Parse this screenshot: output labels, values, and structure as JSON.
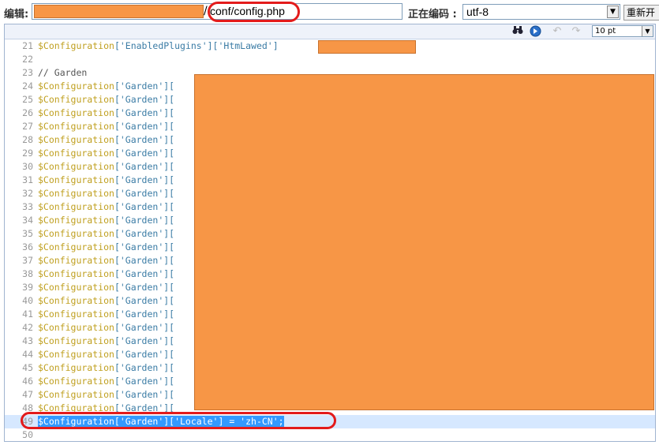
{
  "topbar": {
    "edit_label": "编辑:",
    "file_path": "conf/config.php",
    "encoding_label": "正在编码 :",
    "encoding_value": "utf-8",
    "reopen_button": "重新开",
    "separator": "/"
  },
  "editor_toolbar": {
    "font_size": "10 pt"
  },
  "editor": {
    "lines": [
      {
        "n": "21",
        "var": "$Configuration",
        "rest": "['EnabledPlugins']['HtmLawed']"
      },
      {
        "n": "22",
        "var": "",
        "rest": ""
      },
      {
        "n": "23",
        "comment": "// Garden"
      },
      {
        "n": "24",
        "var": "$Configuration",
        "rest": "['Garden']["
      },
      {
        "n": "25",
        "var": "$Configuration",
        "rest": "['Garden']["
      },
      {
        "n": "26",
        "var": "$Configuration",
        "rest": "['Garden']["
      },
      {
        "n": "27",
        "var": "$Configuration",
        "rest": "['Garden']["
      },
      {
        "n": "28",
        "var": "$Configuration",
        "rest": "['Garden']["
      },
      {
        "n": "29",
        "var": "$Configuration",
        "rest": "['Garden']["
      },
      {
        "n": "30",
        "var": "$Configuration",
        "rest": "['Garden']["
      },
      {
        "n": "31",
        "var": "$Configuration",
        "rest": "['Garden']["
      },
      {
        "n": "32",
        "var": "$Configuration",
        "rest": "['Garden']["
      },
      {
        "n": "33",
        "var": "$Configuration",
        "rest": "['Garden']["
      },
      {
        "n": "34",
        "var": "$Configuration",
        "rest": "['Garden']["
      },
      {
        "n": "35",
        "var": "$Configuration",
        "rest": "['Garden']["
      },
      {
        "n": "36",
        "var": "$Configuration",
        "rest": "['Garden']["
      },
      {
        "n": "37",
        "var": "$Configuration",
        "rest": "['Garden']["
      },
      {
        "n": "38",
        "var": "$Configuration",
        "rest": "['Garden']["
      },
      {
        "n": "39",
        "var": "$Configuration",
        "rest": "['Garden']["
      },
      {
        "n": "40",
        "var": "$Configuration",
        "rest": "['Garden']["
      },
      {
        "n": "41",
        "var": "$Configuration",
        "rest": "['Garden']["
      },
      {
        "n": "42",
        "var": "$Configuration",
        "rest": "['Garden']["
      },
      {
        "n": "43",
        "var": "$Configuration",
        "rest": "['Garden']["
      },
      {
        "n": "44",
        "var": "$Configuration",
        "rest": "['Garden']["
      },
      {
        "n": "45",
        "var": "$Configuration",
        "rest": "['Garden']["
      },
      {
        "n": "46",
        "var": "$Configuration",
        "rest": "['Garden']["
      },
      {
        "n": "47",
        "var": "$Configuration",
        "rest": "['Garden']["
      },
      {
        "n": "48",
        "var": "$Configuration",
        "rest": "['Garden']["
      },
      {
        "n": "49",
        "selected": true,
        "full": "$Configuration['Garden']['Locale'] = 'zh-CN';"
      },
      {
        "n": "50",
        "var": "",
        "rest": ""
      }
    ]
  },
  "colors": {
    "redaction": "#f79646",
    "highlight_circle": "#e31b1b",
    "selection": "#3399ff"
  },
  "icons": [
    "find-icon",
    "goto-icon",
    "undo-icon",
    "redo-icon"
  ]
}
